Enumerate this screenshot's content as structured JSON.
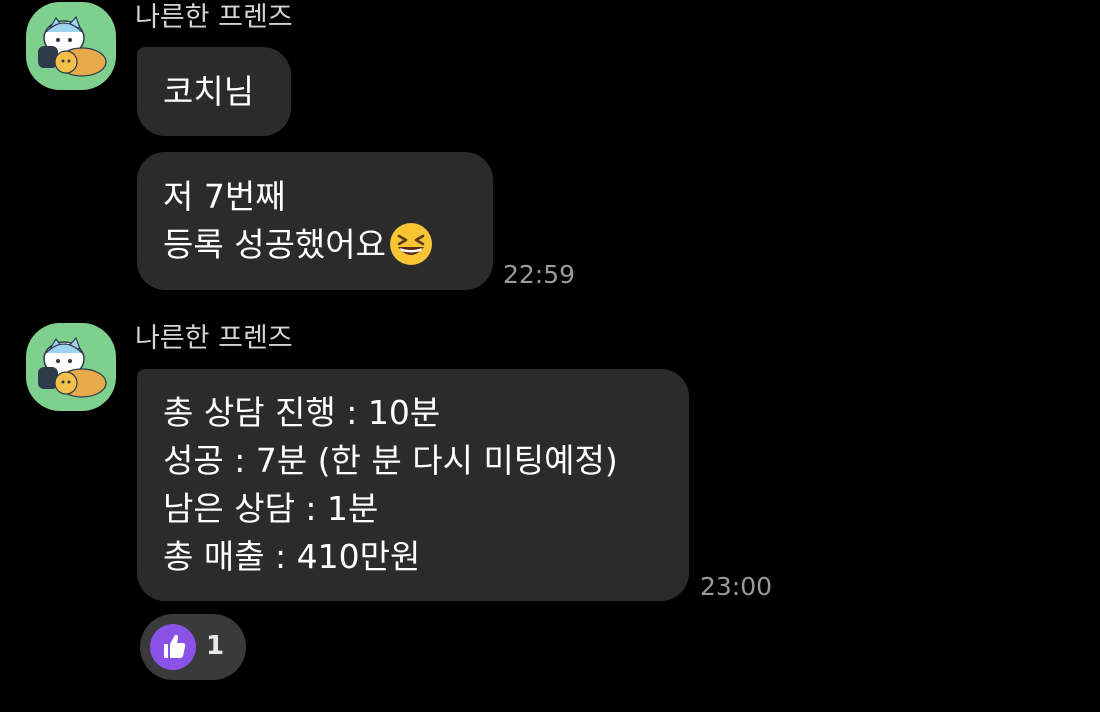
{
  "messages": [
    {
      "sender": "나른한 프렌즈",
      "bubbles": [
        {
          "lines": [
            "코치님"
          ]
        },
        {
          "lines": [
            "저 7번째",
            "등록 성공했어요"
          ],
          "emoji": "grinning-squinting-face-emoji",
          "time": "22:59"
        }
      ]
    },
    {
      "sender": "나른한 프렌즈",
      "bubbles": [
        {
          "lines": [
            "총 상담 진행 : 10분",
            "성공 : 7분 (한 분 다시 미팅예정)",
            "남은 상담 : 1분",
            "총 매출 : 410만원"
          ],
          "time": "23:00",
          "reaction": {
            "icon": "thumbs-up-icon",
            "count": "1"
          }
        }
      ]
    }
  ],
  "colors": {
    "background": "#000000",
    "bubble": "#2b2b2b",
    "avatar_bg": "#7fcf8e",
    "reaction_bg": "#3a3a3a",
    "reaction_accent": "#8a52e6"
  }
}
